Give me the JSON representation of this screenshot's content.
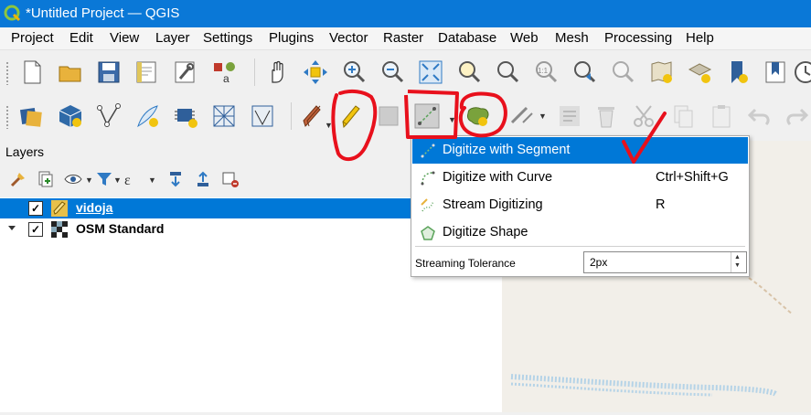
{
  "window": {
    "title": "*Untitled Project — QGIS"
  },
  "menu": [
    "Project",
    "Edit",
    "View",
    "Layer",
    "Settings",
    "Plugins",
    "Vector",
    "Raster",
    "Database",
    "Web",
    "Mesh",
    "Processing",
    "Help"
  ],
  "layers_panel": {
    "title": "Layers",
    "layers": [
      {
        "name": "vidoja",
        "checked": true,
        "selected": true
      },
      {
        "name": "OSM Standard",
        "checked": true,
        "selected": false
      }
    ]
  },
  "digitize_menu": {
    "items": [
      {
        "label": "Digitize with Segment",
        "shortcut": "",
        "icon": "segment-icon",
        "highlighted": true
      },
      {
        "label": "Digitize with Curve",
        "shortcut": "Ctrl+Shift+G",
        "icon": "curve-icon",
        "highlighted": false
      },
      {
        "label": "Stream Digitizing",
        "shortcut": "R",
        "icon": "stream-icon",
        "highlighted": false
      },
      {
        "label": "Digitize Shape",
        "shortcut": "",
        "icon": "shape-icon",
        "highlighted": false
      }
    ],
    "tolerance_label": "Streaming Tolerance",
    "tolerance_value": "2px"
  },
  "colors": {
    "titlebar": "#0a78d7",
    "selection": "#0078d7",
    "annotation": "#e8101c"
  },
  "checkmark": "✓"
}
